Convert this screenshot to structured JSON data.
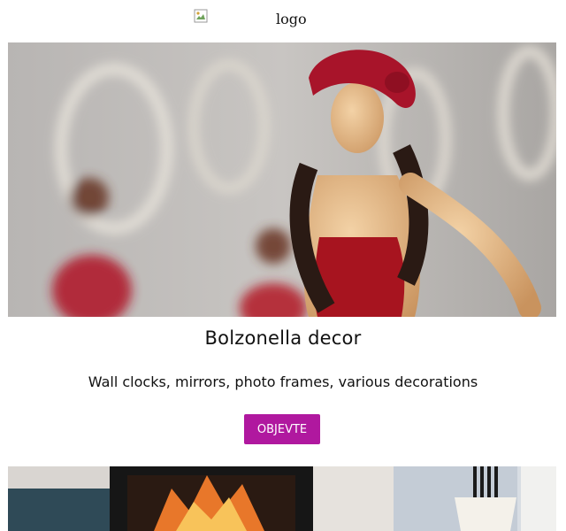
{
  "header": {
    "logo_alt": "logo"
  },
  "hero": {
    "image_subject": "figurine-image"
  },
  "store": {
    "title": "Bolzonella decor",
    "description": "Wall clocks, mirrors, photo frames, various decorations",
    "order_button": "OBJEVTE"
  },
  "colors": {
    "button": "#b0189f",
    "text": "#111111",
    "background": "#ffffff"
  }
}
